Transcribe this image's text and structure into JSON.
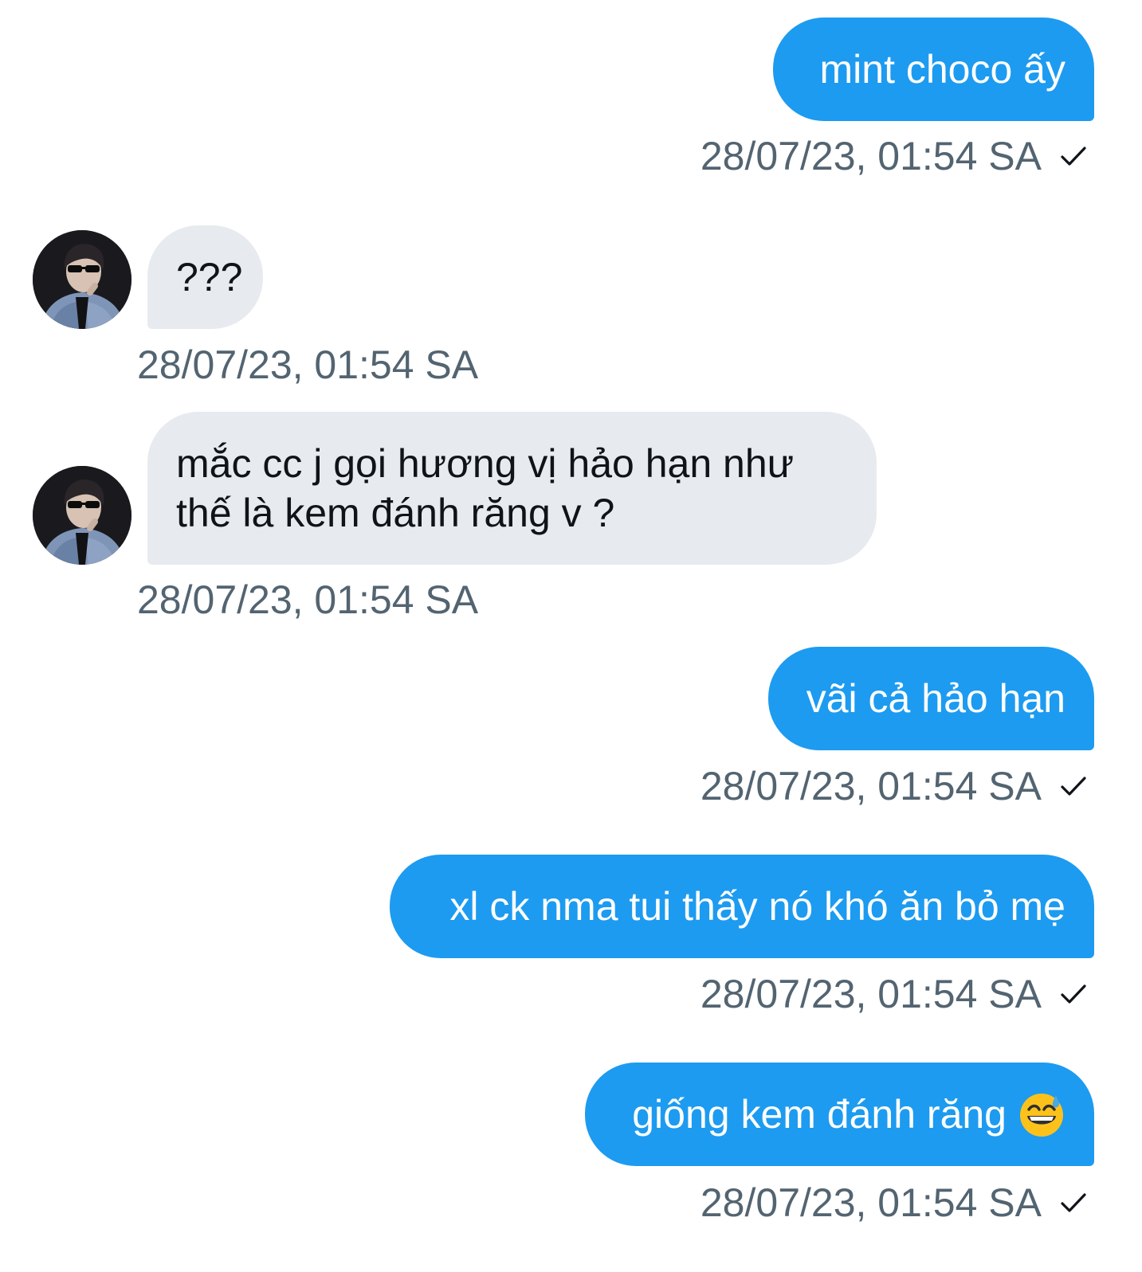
{
  "messages": [
    {
      "direction": "outgoing",
      "text": "mint choco ấy",
      "timestamp": "28/07/23, 01:54 SA",
      "read_icon": "checkmark-icon"
    },
    {
      "direction": "incoming",
      "text": "???",
      "timestamp": "28/07/23, 01:54 SA",
      "avatar": "user-avatar"
    },
    {
      "direction": "incoming",
      "text": "mắc cc j gọi hương vị hảo hạn như thế là kem đánh răng v ?",
      "timestamp": "28/07/23, 01:54 SA",
      "avatar": "user-avatar"
    },
    {
      "direction": "outgoing",
      "text": "vãi cả hảo hạn",
      "timestamp": "28/07/23, 01:54 SA",
      "read_icon": "checkmark-icon"
    },
    {
      "direction": "outgoing",
      "text": "xl ck nma tui thấy nó khó ăn bỏ mẹ",
      "timestamp": "28/07/23, 01:54 SA",
      "read_icon": "checkmark-icon"
    },
    {
      "direction": "outgoing",
      "text": "giống kem đánh răng",
      "emoji": "grinning-sweat-emoji",
      "timestamp": "28/07/23, 01:54 SA",
      "read_icon": "checkmark-icon"
    }
  ],
  "colors": {
    "outgoing_bubble": "#1d9bf0",
    "incoming_bubble": "#e7eaee",
    "timestamp_text": "#536471"
  }
}
